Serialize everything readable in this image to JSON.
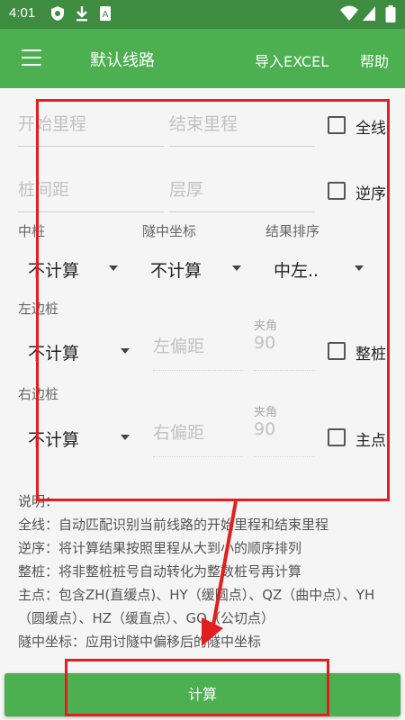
{
  "status": {
    "time": "4:01"
  },
  "appbar": {
    "title": "默认线路",
    "import_label": "导入EXCEL",
    "help_label": "帮助"
  },
  "form": {
    "start_mileage_placeholder": "开始里程",
    "end_mileage_placeholder": "结束里程",
    "full_line_label": "全线",
    "pile_spacing_placeholder": "桩间距",
    "layer_thickness_placeholder": "层厚",
    "reverse_label": "逆序",
    "middle_pile_label": "中桩",
    "tunnel_coord_label": "隧中坐标",
    "result_sort_label": "结果排序",
    "middle_pile_value": "不计算",
    "tunnel_coord_value": "不计算",
    "result_sort_value": "中左..",
    "left_pile_label": "左边桩",
    "left_pile_value": "不计算",
    "left_offset_placeholder": "左偏距",
    "angle_label": "夹角",
    "left_angle_value": "90",
    "integer_pile_label": "整桩",
    "right_pile_label": "右边桩",
    "right_pile_value": "不计算",
    "right_offset_placeholder": "右偏距",
    "right_angle_value": "90",
    "main_point_label": "主点"
  },
  "notes": [
    "说明：",
    "全线：自动匹配识别当前线路的开始里程和结束里程",
    "逆序：将计算结果按照里程从大到小的顺序排列",
    "整桩：将非整桩桩号自动转化为整数桩号再计算",
    "主点：包含ZH(直缓点)、HY（缓圆点）、QZ（曲中点）、YH（圆缓点）、HZ（缓直点）、GQ（公切点）",
    "隧中坐标：应用讨隧中偏移后的隧中坐标"
  ],
  "calc_button": "计算",
  "colors": {
    "primary": "#4caf50",
    "status": "#3d8c40",
    "highlight": "#e02020"
  }
}
